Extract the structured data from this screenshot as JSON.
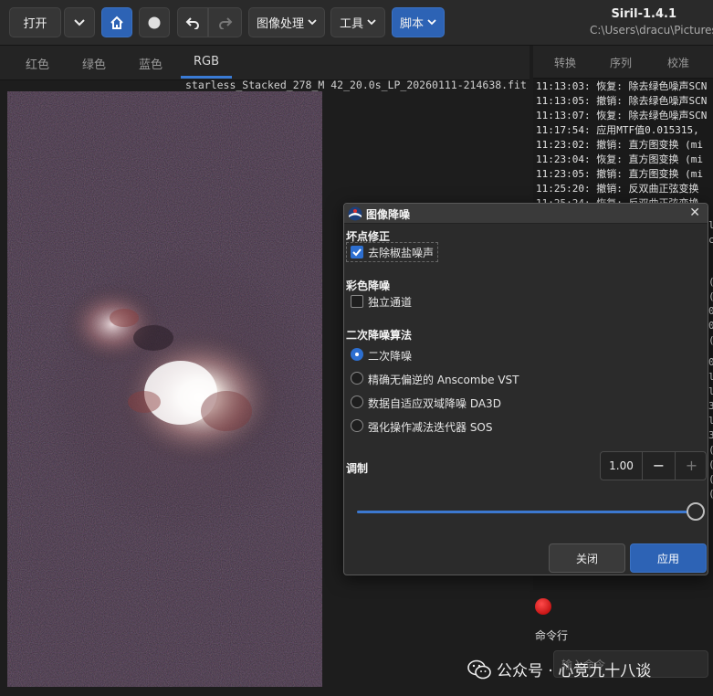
{
  "toolbar": {
    "open_label": "打开",
    "image_processing_label": "图像处理",
    "tools_label": "工具",
    "scripts_label": "脚本"
  },
  "window": {
    "title": "Siril-1.4.1",
    "path": "C:\\Users\\dracu\\Pictures"
  },
  "channel_tabs": [
    "红色",
    "绿色",
    "蓝色",
    "RGB"
  ],
  "right_tabs": [
    "转换",
    "序列",
    "校准"
  ],
  "image": {
    "filename": "starless_Stacked_278_M 42_20.0s_LP_20260111-214638.fit"
  },
  "console": {
    "lines": [
      "11:13:03: 恢复: 除去绿色噪声SCN",
      "11:13:05: 撤销: 除去绿色噪声SCN",
      "11:13:07: 恢复: 除去绿色噪声SCN",
      "11:17:54: 应用MTF值0.015315,",
      "11:23:02: 撤销: 直方图变换 (mi",
      "11:23:04: 恢复: 直方图变换 (mi",
      "11:23:05: 撤销: 直方图变换 (mi",
      "11:25:20: 撤销: 反双曲正弦变换",
      "11:25:24: 恢复: 反双曲正弦变换"
    ],
    "right_edge_chars": [
      "l",
      "c",
      "(",
      "(",
      "0",
      "0",
      "(",
      "0",
      "l",
      "l",
      "3",
      "l",
      "3",
      "(",
      "(",
      "(",
      "("
    ]
  },
  "command": {
    "label": "命令行",
    "placeholder": "输入命令"
  },
  "watermark": {
    "text": "公众号 · 心竞九十八谈"
  },
  "dialog": {
    "title": "图像降噪",
    "bad_pixel_section": "坏点修正",
    "salt_pepper_label": "去除椒盐噪声",
    "salt_pepper_checked": true,
    "color_section": "彩色降噪",
    "independent_channels_label": "独立通道",
    "independent_channels_checked": false,
    "secondary_section": "二次降噪算法",
    "algorithms": [
      {
        "label": "二次降噪",
        "selected": true
      },
      {
        "label": "精确无偏逆的 Anscombe VST",
        "selected": false
      },
      {
        "label": "数据自适应双域降噪 DA3D",
        "selected": false
      },
      {
        "label": "强化操作减法迭代器 SOS",
        "selected": false
      }
    ],
    "modulation_label": "调制",
    "modulation_value": "1.00",
    "modulation_fraction": 1.0,
    "minus_label": "−",
    "plus_label": "+",
    "close_label": "关闭",
    "apply_label": "应用"
  },
  "colors": {
    "accent": "#2d63b5",
    "tab_underline": "#3a7bd5",
    "record": "#d01010"
  }
}
